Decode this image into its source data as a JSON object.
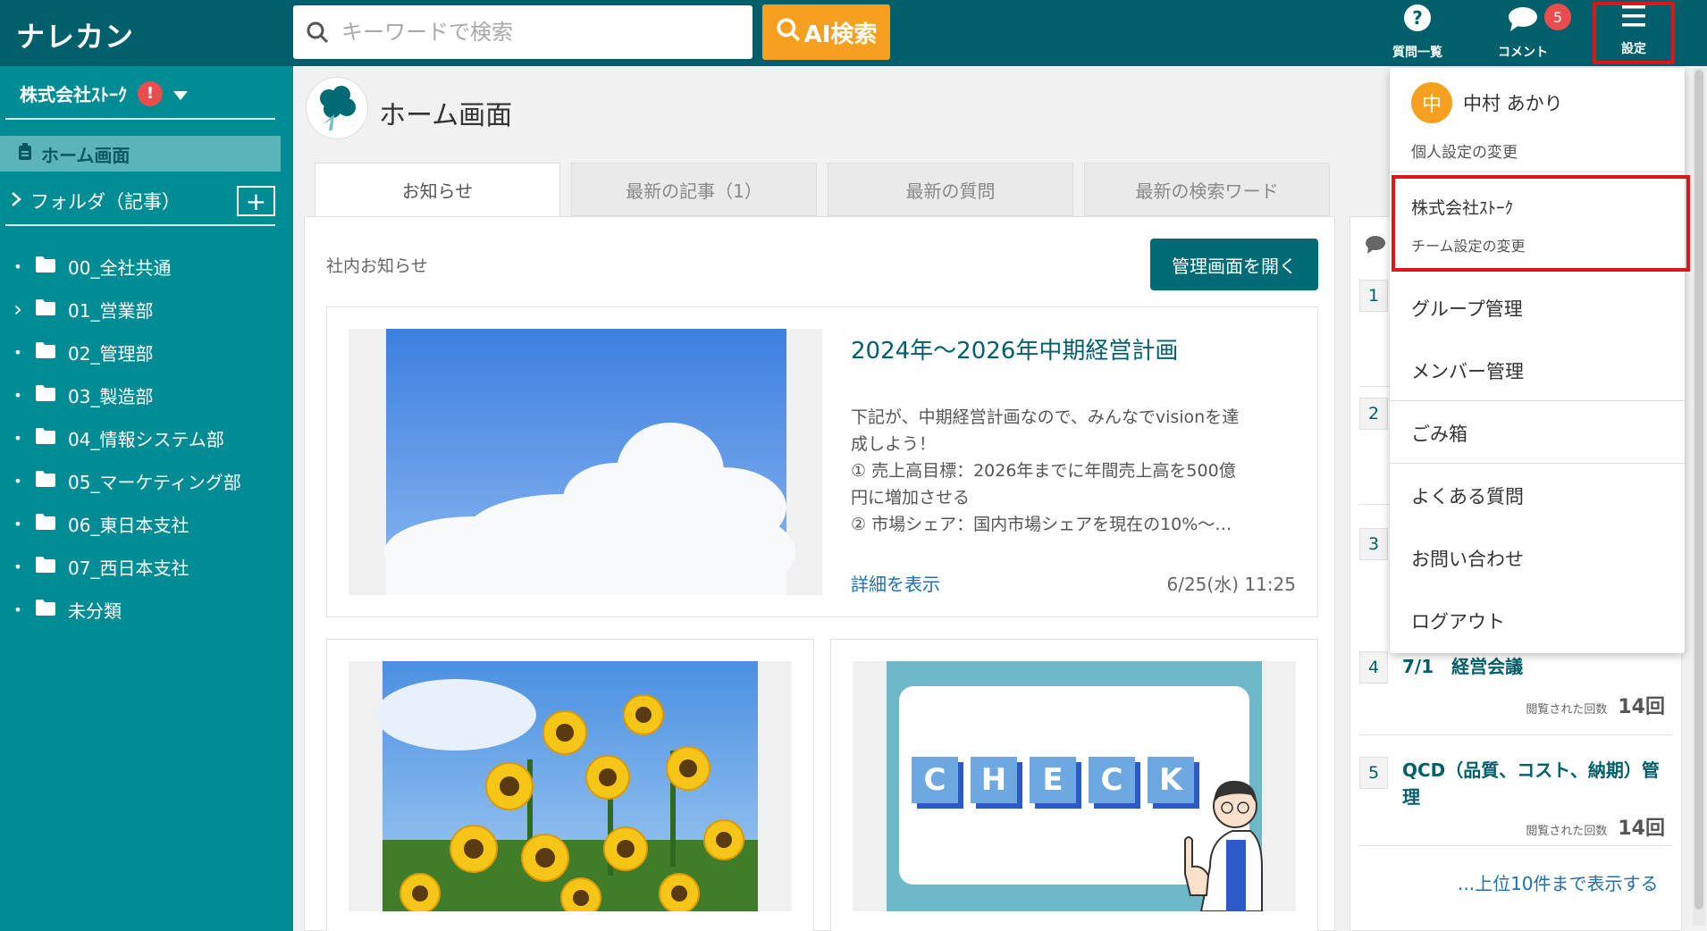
{
  "header": {
    "logo": "ナレカン",
    "search_placeholder": "キーワードで検索",
    "ai_search_label": "AI検索",
    "questions_label": "質問一覧",
    "comments_label": "コメント",
    "comments_badge": "5",
    "settings_label": "設定"
  },
  "sidebar": {
    "company": "株式会社ｽﾄｰｸ",
    "warning": "!",
    "home_label": "ホーム画面",
    "folder_heading": "フォルダ（記事）",
    "add_label": "+",
    "folders": [
      {
        "bullet": "•",
        "label": "00_全社共通"
      },
      {
        "bullet": "›",
        "label": "01_営業部"
      },
      {
        "bullet": "•",
        "label": "02_管理部"
      },
      {
        "bullet": "•",
        "label": "03_製造部"
      },
      {
        "bullet": "•",
        "label": "04_情報システム部"
      },
      {
        "bullet": "•",
        "label": "05_マーケティング部"
      },
      {
        "bullet": "•",
        "label": "06_東日本支社"
      },
      {
        "bullet": "•",
        "label": "07_西日本支社"
      },
      {
        "bullet": "•",
        "label": "未分類"
      }
    ]
  },
  "main": {
    "page_title": "ホーム画面",
    "tabs": [
      "お知らせ",
      "最新の記事（1）",
      "最新の質問",
      "最新の検索ワード"
    ],
    "section_label": "社内お知らせ",
    "admin_button": "管理画面を開く",
    "featured": {
      "title": "2024年～2026年中期経営計画",
      "body_lines": [
        "下記が、中期経営計画なので、みんなでvisionを達",
        "成しよう！",
        "① 売上高目標：2026年までに年間売上高を500億",
        "円に増加させる",
        "② 市場シェア：国内市場シェアを現在の10%～…"
      ],
      "link": "詳細を表示",
      "date": "6/25(水) 11:25"
    },
    "check_letters": [
      "C",
      "H",
      "E",
      "C",
      "K"
    ]
  },
  "ranking": {
    "items": [
      {
        "num": "1"
      },
      {
        "num": "2"
      },
      {
        "num": "3"
      },
      {
        "num": "4",
        "title": "7/1　経営会議",
        "views_label": "閲覧された回数",
        "views": "14回"
      },
      {
        "num": "5",
        "title": "QCD（品質、コスト、納期）管理",
        "views_label": "閲覧された回数",
        "views": "14回"
      }
    ],
    "more": "...上位10件まで表示する"
  },
  "dropdown": {
    "avatar": "中",
    "user_name": "中村 あかり",
    "personal_settings": "個人設定の変更",
    "team_name": "株式会社ｽﾄｰｸ",
    "team_settings": "チーム設定の変更",
    "group": "グループ管理",
    "member": "メンバー管理",
    "trash": "ごみ箱",
    "faq": "よくある質問",
    "contact": "お問い合わせ",
    "logout": "ログアウト"
  }
}
